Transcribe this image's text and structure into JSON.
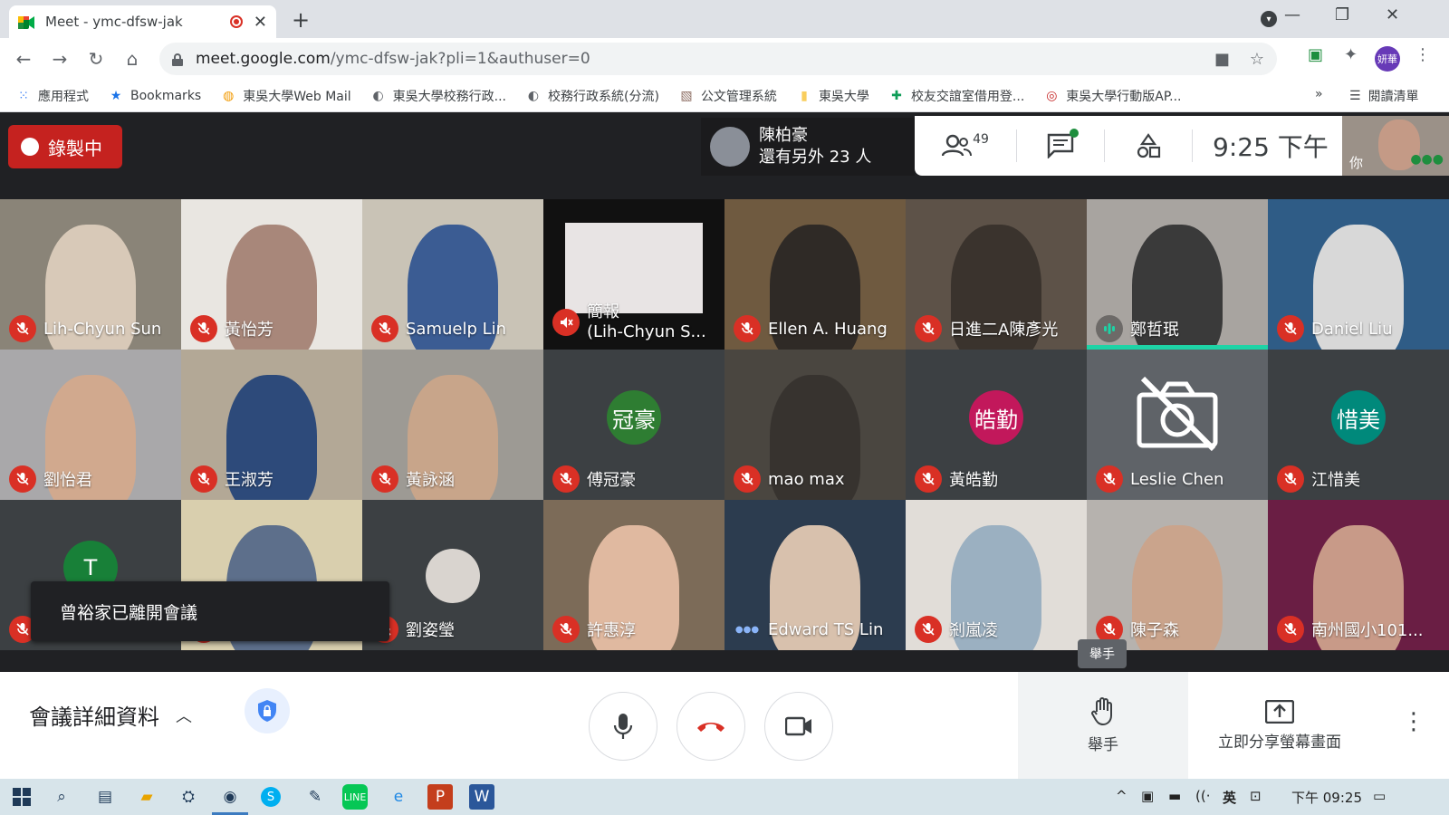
{
  "browser": {
    "tab_title": "Meet - ymc-dfsw-jak",
    "close_symbol": "✕",
    "new_tab_symbol": "+",
    "url_host": "meet.google.com",
    "url_path": "/ymc-dfsw-jak?pli=1&authuser=0",
    "profile_initials": "妍華",
    "bookmarks": [
      {
        "label": "應用程式",
        "icon": "apps-grid-icon",
        "color": "#4285f4"
      },
      {
        "label": "Bookmarks",
        "icon": "star-icon",
        "color": "#1a73e8"
      },
      {
        "label": "東吳大學Web Mail",
        "icon": "mail-icon",
        "color": "#f29900"
      },
      {
        "label": "東吳大學校務行政...",
        "icon": "globe-icon",
        "color": "#5f6368"
      },
      {
        "label": "校務行政系統(分流)",
        "icon": "globe-icon",
        "color": "#5f6368"
      },
      {
        "label": "公文管理系統",
        "icon": "doc-image-icon",
        "color": "#8d6e63"
      },
      {
        "label": "東吳大學",
        "icon": "folder-icon",
        "color": "#f9ce5d"
      },
      {
        "label": "校友交誼室借用登...",
        "icon": "plus-sheet-icon",
        "color": "#0f9d58"
      },
      {
        "label": "東吳大學行動版AP...",
        "icon": "seal-icon",
        "color": "#c62828"
      }
    ],
    "bookmarks_more": "»",
    "reading_list": "閱讀清單"
  },
  "meet": {
    "recording_label": "錄製中",
    "presenter_name": "陳柏豪",
    "presenter_others": "還有另外 23 人",
    "participants_count": "49",
    "clock": "9:25 下午",
    "self_label": "你",
    "toast": "曾裕家已離開會議",
    "raise_tooltip": "舉手",
    "details_label": "會議詳細資料",
    "raise_hand_label": "舉手",
    "share_label": "立即分享螢幕畫面",
    "tiles": [
      {
        "name": "Lih-Chyun Sun",
        "mic": "off"
      },
      {
        "name": "黃怡芳",
        "mic": "off"
      },
      {
        "name": "Samuelp Lin",
        "mic": "off"
      },
      {
        "name": "簡報\n(Lih-Chyun S...",
        "mic": "muted-audio"
      },
      {
        "name": "Ellen A. Huang",
        "mic": "off"
      },
      {
        "name": "日進二A陳彥光",
        "mic": "off"
      },
      {
        "name": "鄭哲珉",
        "mic": "speaking"
      },
      {
        "name": "Daniel Liu",
        "mic": "off"
      },
      {
        "name": "劉怡君",
        "mic": "off"
      },
      {
        "name": "王淑芳",
        "mic": "off"
      },
      {
        "name": "黃詠涵",
        "mic": "off"
      },
      {
        "name": "傅冠豪",
        "mic": "off",
        "initial": "冠豪",
        "initial_color": "#2e7d32"
      },
      {
        "name": "mao max",
        "mic": "off"
      },
      {
        "name": "黃皓勤",
        "mic": "off",
        "initial": "皓勤",
        "initial_color": "#c2185b"
      },
      {
        "name": "Leslie Chen",
        "mic": "off"
      },
      {
        "name": "江惜美",
        "mic": "off",
        "initial": "惜美",
        "initial_color": "#00897b"
      },
      {
        "name": "",
        "mic": "off",
        "initial": "T",
        "initial_color": "#188038"
      },
      {
        "name": "",
        "mic": "off"
      },
      {
        "name": "劉姿瑩",
        "mic": "off"
      },
      {
        "name": "許惠淳",
        "mic": "off"
      },
      {
        "name": "Edward TS Lin",
        "mic": "dots"
      },
      {
        "name": "剎嵐凌",
        "mic": "off"
      },
      {
        "name": "陳子森",
        "mic": "off"
      },
      {
        "name": "南州國小101...",
        "mic": "off"
      }
    ]
  },
  "taskbar": {
    "ime": "英",
    "clock": "下午 09:25"
  }
}
